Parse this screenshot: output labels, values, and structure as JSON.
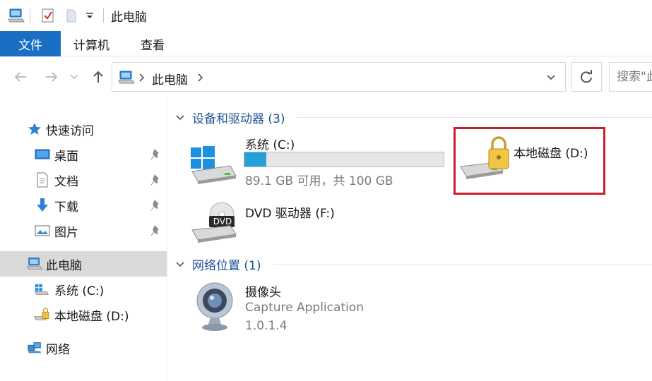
{
  "window": {
    "title": "此电脑"
  },
  "ribbon": {
    "tabs": [
      {
        "label": "文件",
        "active": true
      },
      {
        "label": "计算机"
      },
      {
        "label": "查看"
      }
    ]
  },
  "address": {
    "location": "此电脑",
    "search_placeholder": "搜索\"此电脑\""
  },
  "sidebar": {
    "quick_access": "快速访问",
    "pinned": [
      {
        "label": "桌面",
        "icon": "desktop-icon"
      },
      {
        "label": "文档",
        "icon": "document-icon"
      },
      {
        "label": "下载",
        "icon": "download-icon"
      },
      {
        "label": "图片",
        "icon": "picture-icon"
      }
    ],
    "this_pc": "此电脑",
    "drives": [
      {
        "label": "系统 (C:)",
        "icon": "windows-drive-icon"
      },
      {
        "label": "本地磁盘 (D:)",
        "icon": "locked-drive-icon"
      }
    ],
    "network": "网络"
  },
  "content": {
    "devices_group": "设备和驱动器 (3)",
    "drives": [
      {
        "name": "系统 (C:)",
        "space": "89.1 GB 可用，共 100 GB",
        "used_fraction": 0.109,
        "icon": "windows-drive-icon"
      },
      {
        "name": "本地磁盘 (D:)",
        "icon": "locked-drive-icon",
        "highlighted": true
      },
      {
        "name": "DVD 驱动器 (F:)",
        "icon": "dvd-drive-icon",
        "badge": "DVD"
      }
    ],
    "network_group": "网络位置 (1)",
    "network_items": [
      {
        "name": "摄像头",
        "description": "Capture Application",
        "version": "1.0.1.4",
        "icon": "webcam-icon"
      }
    ]
  },
  "colors": {
    "accent": "#1a6fc4",
    "bar_fill": "#26a0da",
    "group_header": "#1e4f93",
    "highlight": "#c8202a",
    "selected": "#d9d9d9"
  }
}
